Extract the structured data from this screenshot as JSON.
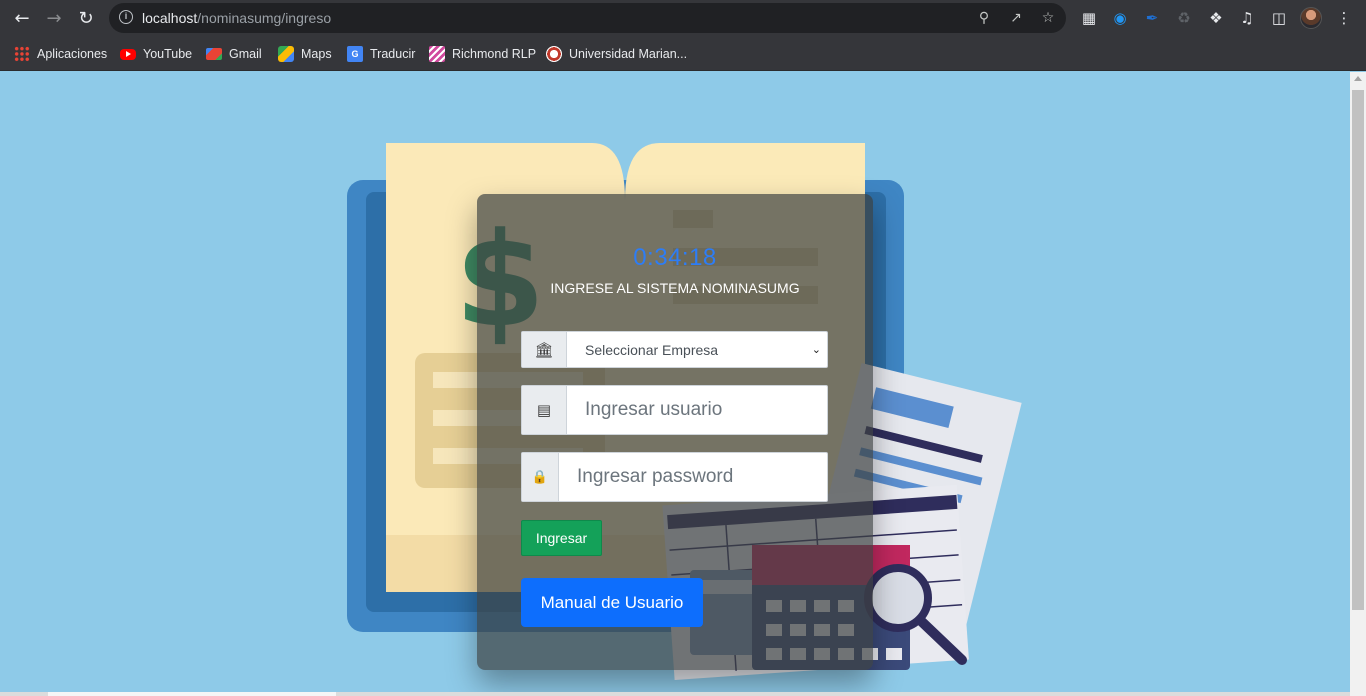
{
  "browser": {
    "url_host": "localhost",
    "url_path": "/nominasumg/ingreso",
    "bookmarks": [
      {
        "label": "Aplicaciones",
        "icon": "apps-grid-icon"
      },
      {
        "label": "YouTube",
        "icon": "youtube-icon"
      },
      {
        "label": "Gmail",
        "icon": "gmail-icon"
      },
      {
        "label": "Maps",
        "icon": "maps-icon"
      },
      {
        "label": "Traducir",
        "icon": "translate-icon"
      },
      {
        "label": "Richmond RLP",
        "icon": "richmond-icon"
      },
      {
        "label": "Universidad Marian...",
        "icon": "university-icon"
      }
    ]
  },
  "login": {
    "clock": "0:34:18",
    "heading": "INGRESE AL SISTEMA NOMINASUMG",
    "company_select": "Seleccionar Empresa",
    "user_placeholder": "Ingresar usuario",
    "password_placeholder": "Ingresar password",
    "submit_label": "Ingresar",
    "manual_label": "Manual de Usuario"
  },
  "colors": {
    "page_bg": "#8ecae8",
    "clock": "#2d7df6",
    "submit_button": "#14a159",
    "manual_button": "#0d6efd"
  }
}
